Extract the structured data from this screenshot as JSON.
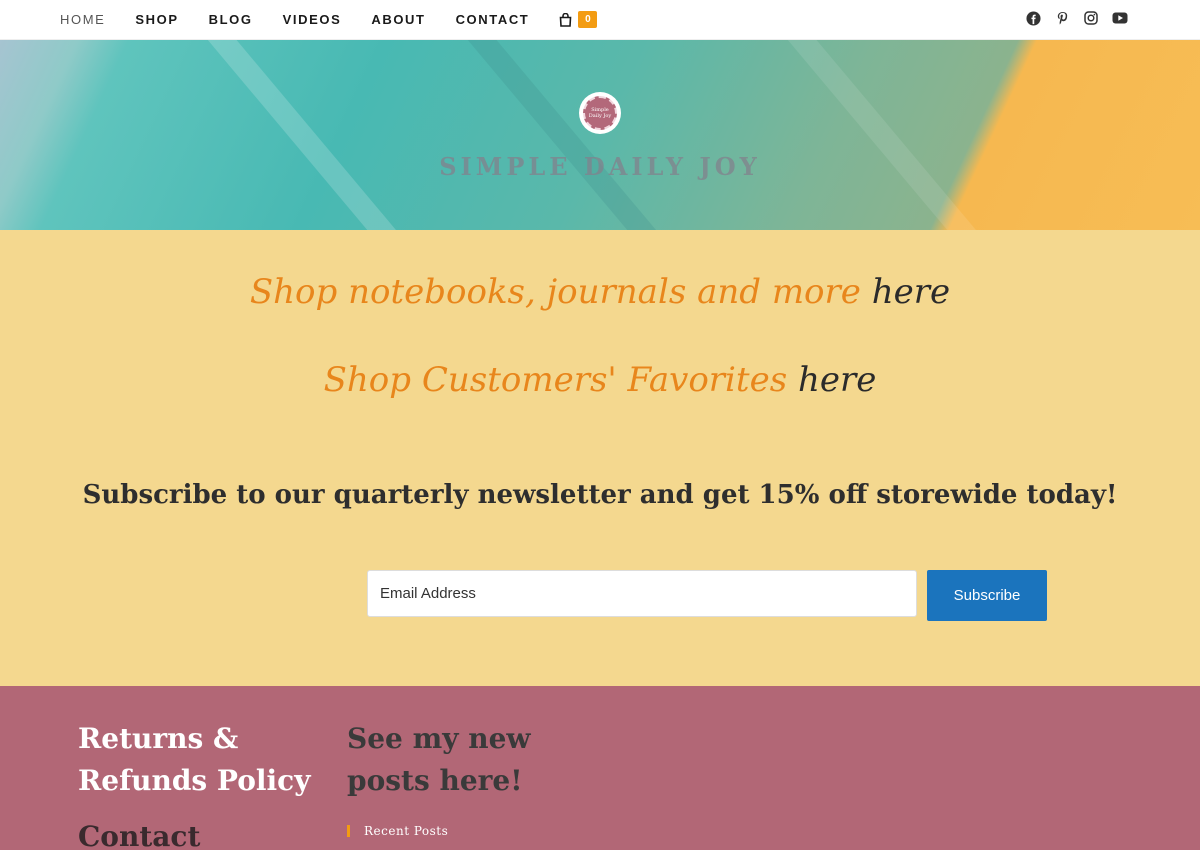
{
  "nav": {
    "items": [
      {
        "label": "HOME",
        "active": true
      },
      {
        "label": "SHOP"
      },
      {
        "label": "BLOG"
      },
      {
        "label": "VIDEOS"
      },
      {
        "label": "ABOUT"
      },
      {
        "label": "CONTACT"
      }
    ],
    "cart_count": "0",
    "socials": [
      "facebook-icon",
      "pinterest-icon",
      "instagram-icon",
      "youtube-icon"
    ]
  },
  "hero": {
    "logo_text": "Simple Daily Joy",
    "site_title": "SIMPLE DAILY JOY"
  },
  "promo": {
    "line1_text": "Shop notebooks, journals and more",
    "line1_link": "here",
    "line2_text": "Shop Customers' Favorites",
    "line2_link": "here",
    "subscribe_heading": "Subscribe to our quarterly newsletter and get 15% off storewide today!",
    "email_placeholder": "Email Address",
    "subscribe_label": "Subscribe"
  },
  "footer": {
    "returns_line1": "Returns &",
    "returns_line2": "Refunds Policy",
    "contact": "Contact",
    "posts_line1": "See my new",
    "posts_line2": "posts here!",
    "recent_posts": "Recent Posts"
  },
  "colors": {
    "accent_orange": "#e8861c",
    "promo_bg": "#f4d88f",
    "footer_bg": "#b26776",
    "button_blue": "#1b74bd",
    "cart_badge": "#f39c12"
  }
}
